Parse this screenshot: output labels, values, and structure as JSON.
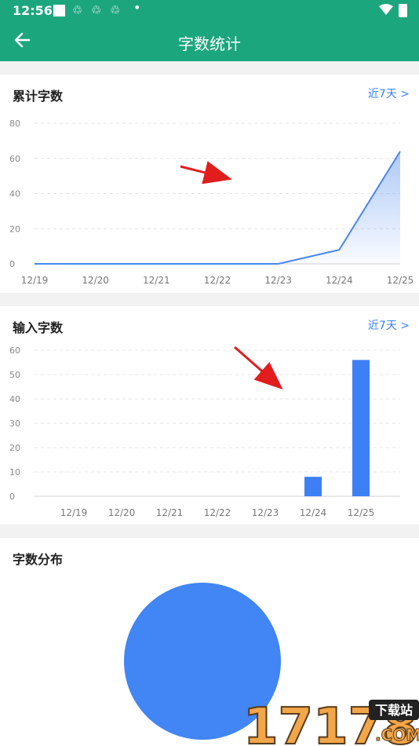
{
  "status_bar": {
    "time": "12:56",
    "icons": [
      "square-icon",
      "recycle-icon",
      "recycle-icon",
      "recycle-icon",
      "dot-icon",
      "wifi-icon",
      "battery-icon"
    ]
  },
  "app_bar": {
    "title": "字数统计",
    "back_icon": "arrow-left-icon"
  },
  "cards": {
    "cumulative": {
      "title": "累计字数",
      "range_label": "近7天 >"
    },
    "input": {
      "title": "输入字数",
      "range_label": "近7天 >"
    },
    "distribution": {
      "title": "字数分布"
    }
  },
  "chart_data": [
    {
      "type": "area",
      "categories": [
        "12/19",
        "12/20",
        "12/21",
        "12/22",
        "12/23",
        "12/24",
        "12/25"
      ],
      "values": [
        0,
        0,
        0,
        0,
        0,
        8,
        64
      ],
      "ylim": [
        0,
        80
      ],
      "yticks": [
        0,
        20,
        40,
        60,
        80
      ],
      "grid": true,
      "color": "#4a86f0"
    },
    {
      "type": "bar",
      "categories": [
        "12/19",
        "12/20",
        "12/21",
        "12/22",
        "12/23",
        "12/24",
        "12/25"
      ],
      "values": [
        0,
        0,
        0,
        0,
        0,
        8,
        56
      ],
      "ylim": [
        0,
        60
      ],
      "yticks": [
        0,
        10,
        20,
        30,
        40,
        50,
        60
      ],
      "grid": true,
      "color": "#3d7ff5"
    },
    {
      "type": "pie",
      "values": [
        100
      ],
      "color": "#4285f4"
    }
  ],
  "watermark": {
    "text": "17178",
    "badge": "下载站",
    "suffix": ".COM"
  },
  "colors": {
    "header": "#1ca67e",
    "accent": "#3b82f6",
    "arrow": "#e11d1d"
  }
}
